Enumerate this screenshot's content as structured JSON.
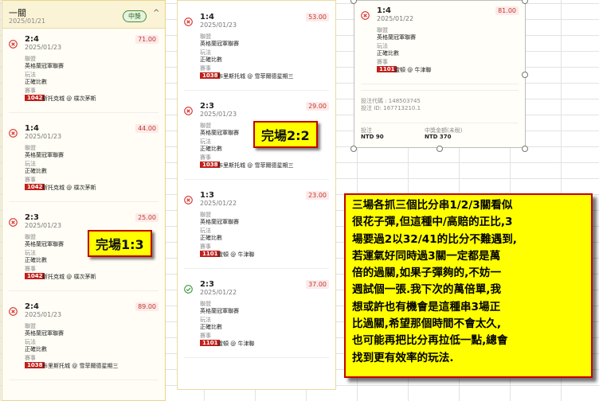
{
  "colors": {
    "loss": "#d9302c",
    "win": "#3a9a3a",
    "code_bg": "#c0201b",
    "callout": "#ffff00",
    "callout_border": "#c40000"
  },
  "left_panel": {
    "title": "一關",
    "date": "2025/01/21",
    "badge": "中獎",
    "chevron": "^",
    "cards": [
      {
        "status": "loss",
        "score": "2:4",
        "date": "2025/01/23",
        "odds": "71.00",
        "league_label": "聯盟",
        "league": "英格蘭冠軍聯賽",
        "play_label": "玩法",
        "play": "正確比數",
        "match_label": "賽事",
        "code": "1042",
        "match": "斯托克城 @ 樸次茅斯"
      },
      {
        "status": "loss",
        "score": "1:4",
        "date": "2025/01/23",
        "odds": "44.00",
        "league_label": "聯盟",
        "league": "英格蘭冠軍聯賽",
        "play_label": "玩法",
        "play": "正確比數",
        "match_label": "賽事",
        "code": "1042",
        "match": "斯托克城 @ 樸次茅斯"
      },
      {
        "status": "loss",
        "score": "2:3",
        "date": "2025/01/23",
        "odds": "25.00",
        "league_label": "聯盟",
        "league": "英格蘭冠軍聯賽",
        "play_label": "玩法",
        "play": "正確比數",
        "match_label": "賽事",
        "code": "1042",
        "match": "斯托克城 @ 樸次茅斯"
      },
      {
        "status": "loss",
        "score": "2:4",
        "date": "2025/01/23",
        "odds": "89.00",
        "league_label": "聯盟",
        "league": "英格蘭冠軍聯賽",
        "play_label": "玩法",
        "play": "正確比數",
        "match_label": "賽事",
        "code": "1038",
        "match": "布里斯托城 @ 雪菲爾德星期三"
      }
    ]
  },
  "mid_panel": {
    "cards": [
      {
        "status": "loss",
        "score": "1:4",
        "date": "2025/01/23",
        "odds": "53.00",
        "league_label": "聯盟",
        "league": "英格蘭冠軍聯賽",
        "play_label": "玩法",
        "play": "正確比數",
        "match_label": "賽事",
        "code": "1038",
        "match": "布里斯托城 @ 雪菲爾德星期三"
      },
      {
        "status": "loss",
        "score": "2:3",
        "date": "2025/01/23",
        "odds": "29.00",
        "league_label": "聯盟",
        "league": "英格蘭冠軍聯賽",
        "play_label": "玩法",
        "play": "正確比數",
        "match_label": "賽事",
        "code": "1038",
        "match": "布里斯托城 @ 雪菲爾德星期三"
      },
      {
        "status": "loss",
        "score": "1:3",
        "date": "2025/01/22",
        "odds": "23.00",
        "league_label": "聯盟",
        "league": "英格蘭冠軍聯賽",
        "play_label": "玩法",
        "play": "正確比數",
        "match_label": "賽事",
        "code": "1101",
        "match": "盧頓 @ 牛津聯"
      },
      {
        "status": "win",
        "score": "2:3",
        "date": "2025/01/22",
        "odds": "37.00",
        "league_label": "聯盟",
        "league": "英格蘭冠軍聯賽",
        "play_label": "玩法",
        "play": "正確比數",
        "match_label": "賽事",
        "code": "1101",
        "match": "盧頓 @ 牛津聯"
      }
    ]
  },
  "right_panel": {
    "card": {
      "status": "loss",
      "score": "1:4",
      "date": "2025/01/22",
      "odds": "81.00",
      "league_label": "聯盟",
      "league": "英格蘭冠軍聯賽",
      "play_label": "玩法",
      "play": "正確比數",
      "match_label": "賽事",
      "code": "1101",
      "match": "盧頓 @ 牛津聯"
    },
    "bet_code": "投注代碼 : 148503745",
    "bet_id": "投注 ID: 167713210.1",
    "stake_label": "投注",
    "stake": "NTD 90",
    "payout_label": "中獎金額(未稅)",
    "payout": "NTD 370"
  },
  "labels": {
    "l13": "完場1:3",
    "l22": "完場2:2"
  },
  "note_lines": [
    "三場各抓三個比分串1/2/3關看似",
    "很花子彈,但這種中/高賠的正比,3",
    "場要過2以32/41的比分不難遇到,",
    "若運氣好同時過3關一定都是萬",
    "倍的過關,如果子彈夠的,不妨一",
    "週試個一張.我下次的萬倍單,我",
    "想或許也有機會是這種串3場正",
    "比過關,希望那個時間不會太久,",
    "也可能再把比分再拉低一點,總會",
    "找到更有效率的玩法."
  ]
}
